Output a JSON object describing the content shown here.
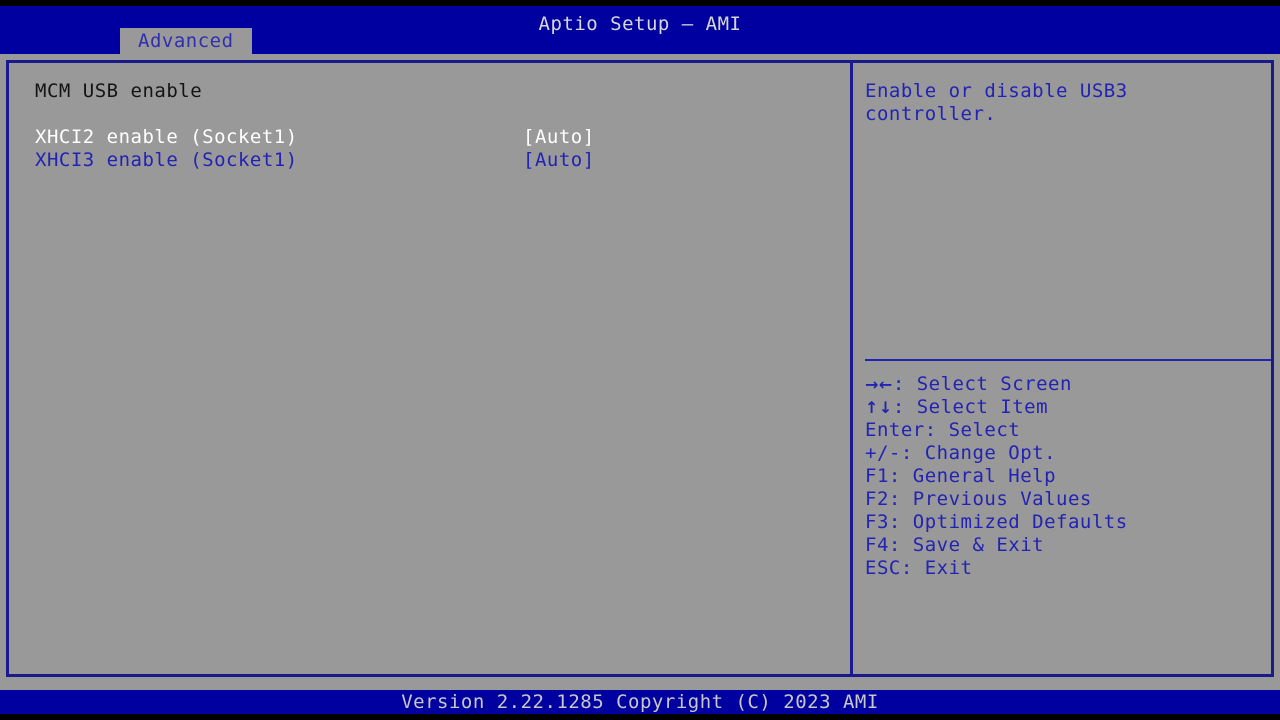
{
  "app": {
    "title": "Aptio Setup – AMI",
    "footer": "Version 2.22.1285 Copyright (C) 2023 AMI"
  },
  "colors": {
    "header_bar": "#0000a0",
    "background": "#999999",
    "border": "#1a1a8c",
    "text_blue": "#2222b4",
    "text_selected": "#ffffff",
    "text_header": "#141414",
    "title_text": "#d8d8d8"
  },
  "menu": {
    "tabs": [
      {
        "label": "Advanced",
        "active": true
      }
    ]
  },
  "settings": {
    "section_header": "MCM USB enable",
    "rows": [
      {
        "label": "XHCI2 enable (Socket1)",
        "value": "[Auto]",
        "selected": true
      },
      {
        "label": "XHCI3 enable (Socket1)",
        "value": "[Auto]",
        "selected": false
      }
    ]
  },
  "help": {
    "text": "Enable or disable USB3\ncontroller.",
    "legend": [
      {
        "glyph": "→←",
        "keys": "",
        "sep": ": ",
        "action": "Select Screen"
      },
      {
        "glyph": "↑↓",
        "keys": "",
        "sep": ": ",
        "action": "Select Item"
      },
      {
        "glyph": "",
        "keys": "Enter",
        "sep": ": ",
        "action": "Select"
      },
      {
        "glyph": "",
        "keys": "+/-",
        "sep": ": ",
        "action": "Change Opt."
      },
      {
        "glyph": "",
        "keys": "F1",
        "sep": ": ",
        "action": "General Help"
      },
      {
        "glyph": "",
        "keys": "F2",
        "sep": ": ",
        "action": "Previous Values"
      },
      {
        "glyph": "",
        "keys": "F3",
        "sep": ": ",
        "action": "Optimized Defaults"
      },
      {
        "glyph": "",
        "keys": "F4",
        "sep": ": ",
        "action": "Save & Exit"
      },
      {
        "glyph": "",
        "keys": "ESC",
        "sep": ": ",
        "action": "Exit"
      }
    ]
  }
}
